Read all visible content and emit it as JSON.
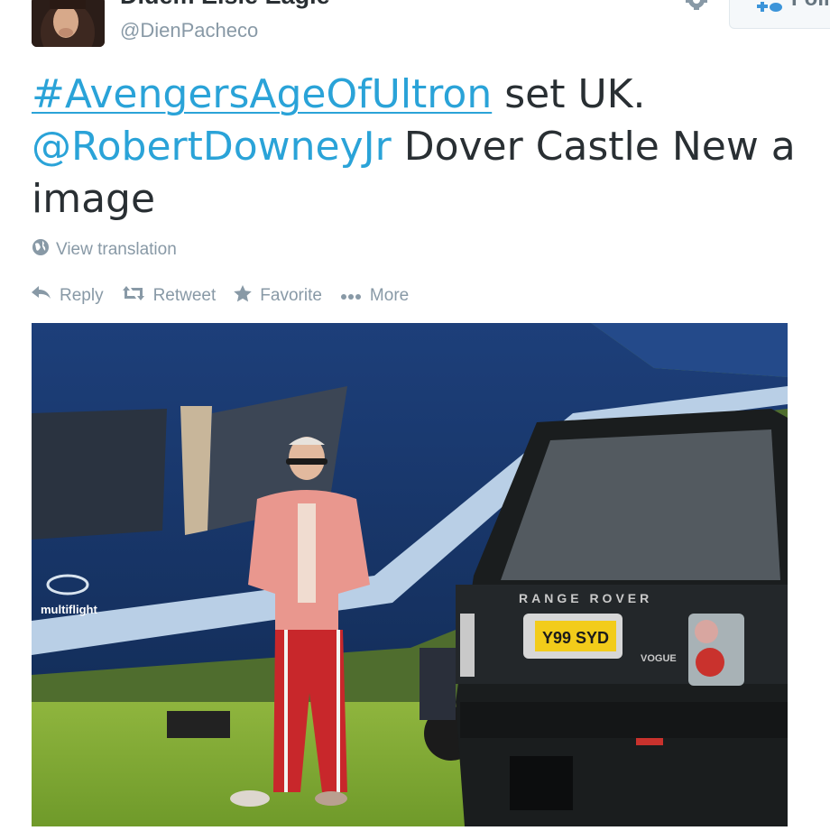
{
  "author": {
    "display_name": "Didem Elsie Eagle",
    "handle": "@DienPacheco"
  },
  "header": {
    "follow_label": "Follo"
  },
  "tweet": {
    "hashtag": "#AvengersAgeOfUltron",
    "text_after_hashtag": " set UK.",
    "mention": "@RobertDowneyJr",
    "text_after_mention": " Dover Castle New a image"
  },
  "translation": {
    "label": "View translation"
  },
  "actions": {
    "reply": "Reply",
    "retweet": "Retweet",
    "favorite": "Favorite",
    "more": "More"
  },
  "photo": {
    "helicopter_brand": "multiflight",
    "car_badge": "RANGE ROVER",
    "plate": "Y99 SYD",
    "car_model": "VOGUE"
  },
  "colors": {
    "link": "#2aa3d8",
    "meta": "#8899a6",
    "text": "#292f33"
  }
}
